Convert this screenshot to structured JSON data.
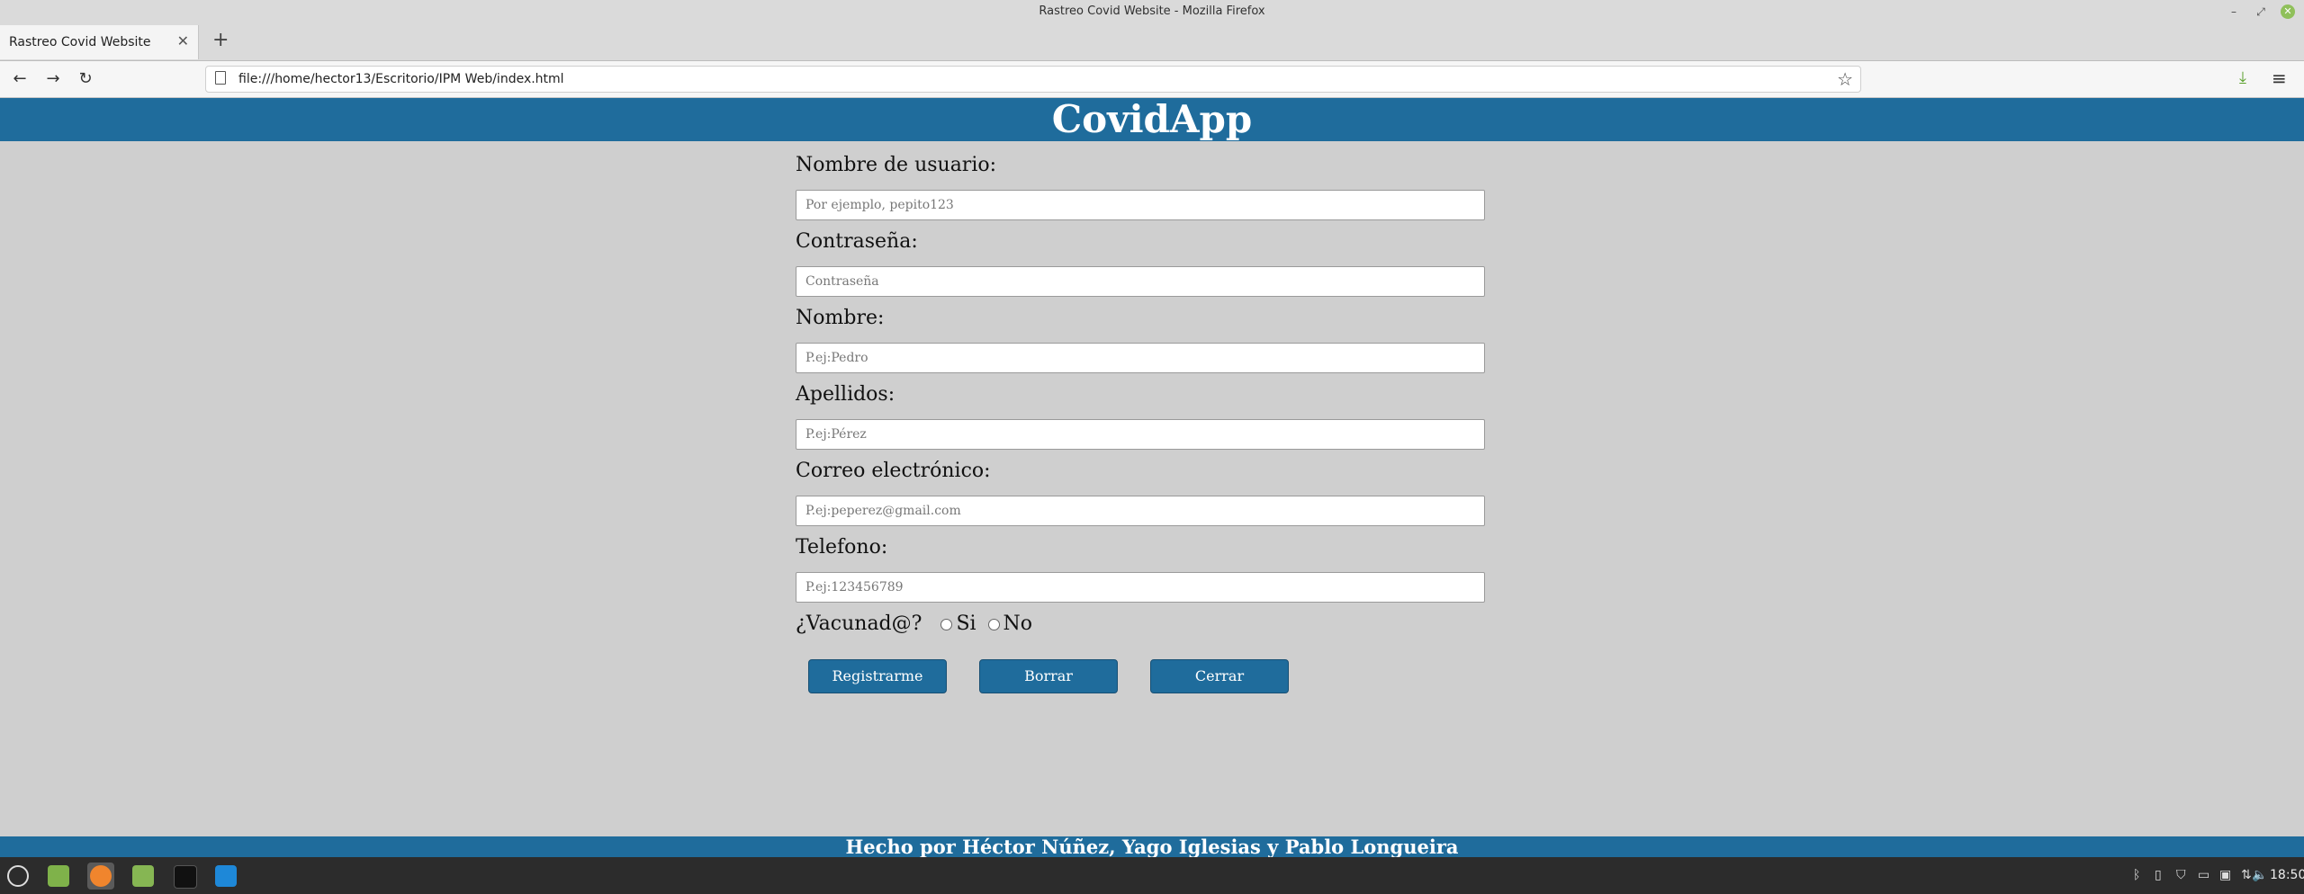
{
  "window": {
    "title": "Rastreo Covid Website - Mozilla Firefox",
    "minimize_glyph": "–",
    "maximize_glyph": "⤢",
    "close_glyph": "✕"
  },
  "browser": {
    "tab_label": "Rastreo Covid Website",
    "tab_close": "✕",
    "new_tab": "+",
    "back": "←",
    "forward": "→",
    "reload": "↻",
    "url": "file:///home/hector13/Escritorio/IPM Web/index.html",
    "bookmark_star": "☆",
    "download": "⤓",
    "menu": "≡"
  },
  "page": {
    "header_title": "CovidApp",
    "fields": {
      "username": {
        "label": "Nombre de usuario:",
        "placeholder": "Por ejemplo, pepito123"
      },
      "password": {
        "label": "Contraseña:",
        "placeholder": "Contraseña"
      },
      "name": {
        "label": "Nombre:",
        "placeholder": "P.ej:Pedro"
      },
      "surname": {
        "label": "Apellidos:",
        "placeholder": "P.ej:Pérez"
      },
      "email": {
        "label": "Correo electrónico:",
        "placeholder": "P.ej:peperez@gmail.com"
      },
      "phone": {
        "label": "Telefono:",
        "placeholder": "P.ej:123456789"
      }
    },
    "vaccinated": {
      "question": "¿Vacunad@?",
      "yes": "Si",
      "no": "No"
    },
    "buttons": {
      "register": "Registrarme",
      "clear": "Borrar",
      "close": "Cerrar"
    },
    "footer": "Hecho por Héctor Núñez, Yago Iglesias y Pablo Longueira"
  },
  "taskbar": {
    "clock": "18:50",
    "apps": [
      "menu-icon",
      "show-desktop-icon",
      "firefox-icon",
      "files-icon",
      "terminal-icon",
      "vscode-icon"
    ]
  },
  "colors": {
    "brand": "#1f6c9c",
    "page_bg": "#cfcfcf"
  }
}
